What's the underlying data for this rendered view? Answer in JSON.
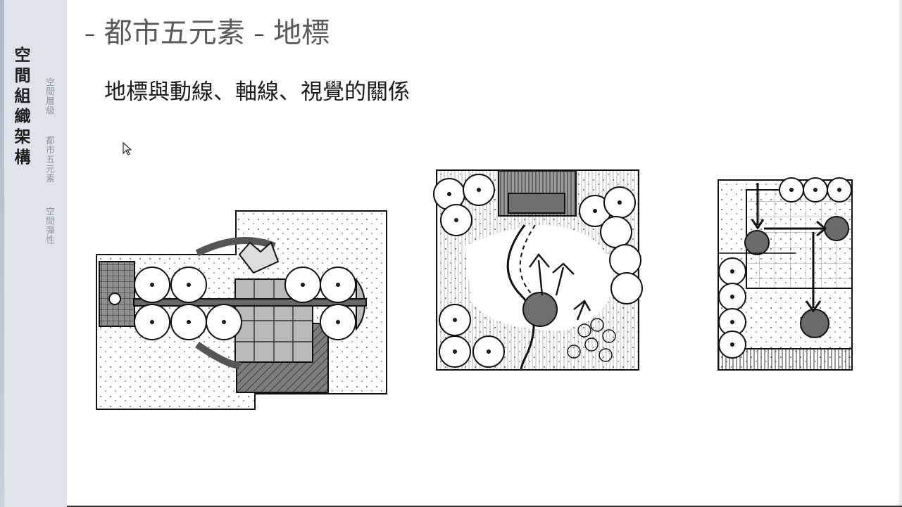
{
  "sidebar": {
    "section_title": "空間組織架構",
    "items": [
      {
        "label": "空間層級"
      },
      {
        "label": "都市五元素"
      },
      {
        "label": "空間彈性"
      }
    ]
  },
  "slide": {
    "title_prefix": "–",
    "title_main": "都市五元素",
    "title_sep": "–",
    "title_sub": "地標",
    "subtitle": "地標與動線、軸線、視覺的關係"
  },
  "figures": [
    {
      "name": "landmark-axis-plan"
    },
    {
      "name": "landmark-path-plan"
    },
    {
      "name": "landmark-view-plan"
    }
  ],
  "icons": {
    "cursor": "mouse-pointer-icon"
  }
}
